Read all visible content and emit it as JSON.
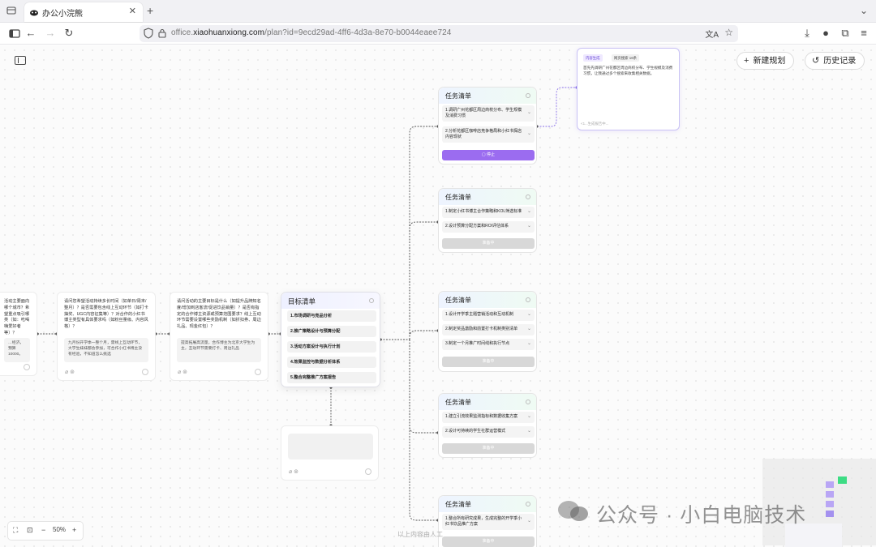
{
  "browser": {
    "tab_title": "办公小浣熊",
    "url_domain": "office.",
    "url_host": "xiaohuanxiong.com",
    "url_path": "/plan?id=9ecd29ad-4ff6-4d3a-8e70-b0044eaee724"
  },
  "header": {
    "new_plan_label": "新建规划",
    "history_label": "历史记录"
  },
  "question_cards": [
    {
      "question": "活动主要面向哪个城市？希望重点吸引哪类（如：吃喝嗨爱好者等）？",
      "answer": "…经济，预算10000。"
    },
    {
      "question": "请问您希望活动持续多长时间（如单日/周末/整月）？是否需要包含线上互动环节（如打卡抽奖、UGC内容征集等）？对合作的小红书博主类型有具体要求吗（如粉丝量级、内容风格）？",
      "answer": "九月份开学季一整个月，需线上互动环节，大学生妹妹都会参加，可合作小红书博主没有经验，不知道怎么挑选"
    },
    {
      "question": "请问活动的主要目标是什么（如提升品牌知名度/增加到店客流/促进饮品销量）？是否有指定的合作博主资源或预算范围要求？线上互动环节需要设置哪些奖励机制（如折扣券、周边礼品、现金红包）？",
      "answer": "提高拓展高流量，合作博主为北京大学生为主，互动环节需要打卡、周边礼品"
    }
  ],
  "goal_list": {
    "title": "目标清单",
    "items": [
      "1.市场调研与竞品分析",
      "2.推广策略设计与预算分配",
      "3.活动方案设计与执行计划",
      "4.效果监控与数据分析体系",
      "5.整合完整推广方案报告"
    ]
  },
  "task_lists": [
    {
      "title": "任务清单",
      "items": [
        "1.调研广州花都区周边商校分布、学生规模及消费习惯",
        "2.分析花都区咖啡店竞争格局和小红书探店内容现状"
      ],
      "button": "停止",
      "active": true
    },
    {
      "title": "任务清单",
      "items": [
        "1.制定小红书博主合作策略和KOL筛选标准",
        "2.设计预算分配方案和ROI评估体系"
      ],
      "button": "准备中",
      "active": false
    },
    {
      "title": "任务清单",
      "items": [
        "1.设计开学季主题营销活动和互动机制",
        "2.制定奖品激励和前置打卡机制类别清单",
        "3.制定一个月推广时间线和执行节点"
      ],
      "button": "准备中",
      "active": false
    },
    {
      "title": "任务清单",
      "items": [
        "1.建立引流效果监测指标和数据收集方案",
        "2.设计可持续的学生社群运营模式"
      ],
      "button": "准备中",
      "active": false
    },
    {
      "title": "任务清单",
      "items": [
        "1.整合所有研究成果，生成完整的开学季小红书饮品推广方案"
      ],
      "button": "准备中",
      "active": false
    }
  ],
  "gen_card": {
    "tag_content": "内容生成",
    "tag_search": "网页搜索 16条",
    "body": "首先先调研广州花都区周边商校分布、学生规模及消费习惯，让我通过多个搜索来收集相关数据。",
    "footer": "<1...生成报告中..."
  },
  "zoom": {
    "level": "50%"
  },
  "bottom_note": "以上内容由人工",
  "watermark": "公众号 · 小白电脑技术",
  "colors": {
    "accent": "#9b6cf0",
    "canvas": "#fbfbfb"
  }
}
